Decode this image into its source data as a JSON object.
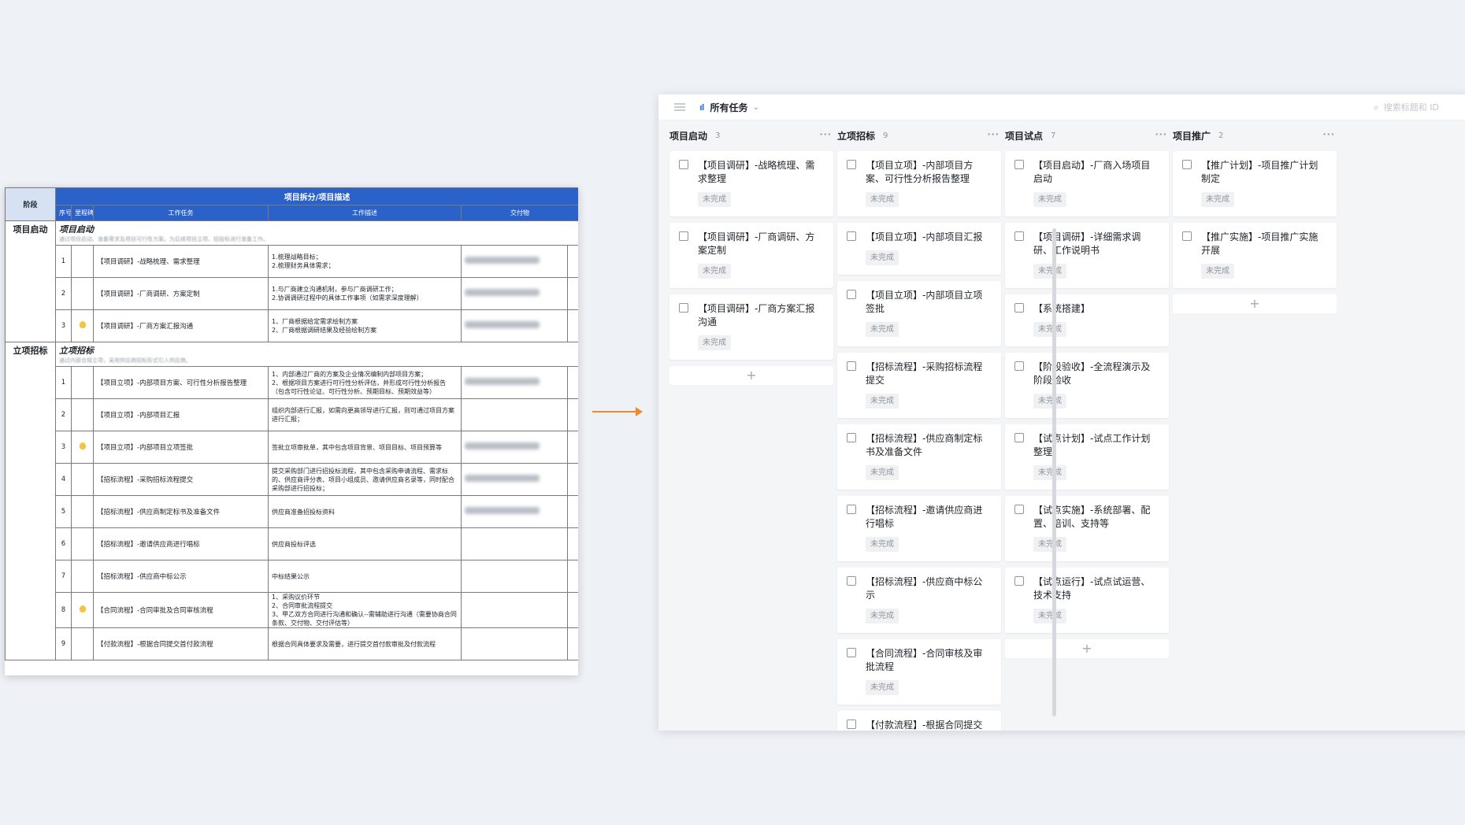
{
  "sheet": {
    "header_stage": "阶段",
    "header_title": "项目拆分/项目描述",
    "col_seq": "序号",
    "col_milestone": "里程碑",
    "col_task": "工作任务",
    "col_desc": "工作描述",
    "col_deliverable": "交付物",
    "sections": [
      {
        "stage": "项目启动",
        "title": "项目启动",
        "desc": "通过项目启动、准备需求及项目可行性方案。为后续项目立项、招投标进行准备工作。",
        "rows": [
          {
            "num": "1",
            "medal": false,
            "task": "【项目调研】-战略梳理、需求整理",
            "desc": "1.梳理战略目标；\n2.梳理财务具体需求；",
            "deliverable": true
          },
          {
            "num": "2",
            "medal": false,
            "task": "【项目调研】-厂商调研、方案定制",
            "desc": "1.与厂商建立沟通机制，参与厂商调研工作；\n2.协调调研过程中的具体工作事项（如需求深度理解）",
            "deliverable": true
          },
          {
            "num": "3",
            "medal": true,
            "task": "【项目调研】-厂商方案汇报沟通",
            "desc": "1、厂商根据给定需求绘制方案\n2、厂商根据调研结果及经验绘制方案",
            "deliverable": true
          }
        ]
      },
      {
        "stage": "立项招标",
        "title": "立项招标",
        "desc": "通过内部合规立项，采用供应商招标形式引入供应商。",
        "rows": [
          {
            "num": "1",
            "medal": false,
            "task": "【项目立项】-内部项目方案、可行性分析报告整理",
            "desc": "1、内部通过厂商的方案及企业情况编制内部项目方案；\n2、根据项目方案进行可行性分析评估，并形成可行性分析报告（包含可行性论证、可行性分析、预期目标、预期效益等）",
            "deliverable": true
          },
          {
            "num": "2",
            "medal": false,
            "task": "【项目立项】-内部项目汇报",
            "desc": "组织内部进行汇报，如需向更高领导进行汇报，则可通过项目方案进行汇报；",
            "deliverable": false
          },
          {
            "num": "3",
            "medal": true,
            "task": "【项目立项】-内部项目立项签批",
            "desc": "签批立项审批单，其中包含项目背景、项目目标、项目预算等",
            "deliverable": true
          },
          {
            "num": "4",
            "medal": false,
            "task": "【招标流程】-采购招标流程提交",
            "desc": "提交采购部门进行招投标流程，其中包含采购申请流程、需求标的、供应商评分表、项目小组成员、邀请供应商名录等，同时配合采购部进行招投标；",
            "deliverable": true
          },
          {
            "num": "5",
            "medal": false,
            "task": "【招标流程】-供应商制定标书及准备文件",
            "desc": "供应商准备招投标资料",
            "deliverable": true
          },
          {
            "num": "6",
            "medal": false,
            "task": "【招标流程】-邀请供应商进行唱标",
            "desc": "供应商投标评选",
            "deliverable": false
          },
          {
            "num": "7",
            "medal": false,
            "task": "【招标流程】-供应商中标公示",
            "desc": "中标结果公示",
            "deliverable": false
          },
          {
            "num": "8",
            "medal": true,
            "task": "【合同流程】-合同审批及合同审核流程",
            "desc": "1、采购议价环节\n2、合同审批流程提交\n3、甲乙双方合同进行沟通和确认--需辅助进行沟通（需要协商合同条款、交付物、交付评估等）",
            "deliverable": false
          },
          {
            "num": "9",
            "medal": false,
            "task": "【付款流程】-根据合同提交首付款流程",
            "desc": "根据合同具体要求及需要，进行提交首付款审批及付款流程",
            "deliverable": false
          }
        ]
      }
    ]
  },
  "board": {
    "view_name": "所有任务",
    "search_placeholder": "搜索标题和 ID",
    "add_symbol": "+",
    "more_symbol": "···",
    "columns": [
      {
        "title": "项目启动",
        "count": "3",
        "cards": [
          {
            "title": "【项目调研】-战略梳理、需求整理",
            "status": "未完成"
          },
          {
            "title": "【项目调研】-厂商调研、方案定制",
            "status": "未完成"
          },
          {
            "title": "【项目调研】-厂商方案汇报沟通",
            "status": "未完成"
          }
        ]
      },
      {
        "title": "立项招标",
        "count": "9",
        "cards": [
          {
            "title": "【项目立项】-内部项目方案、可行性分析报告整理",
            "status": "未完成"
          },
          {
            "title": "【项目立项】-内部项目汇报",
            "status": "未完成"
          },
          {
            "title": "【项目立项】-内部项目立项签批",
            "status": "未完成"
          },
          {
            "title": "【招标流程】-采购招标流程提交",
            "status": "未完成"
          },
          {
            "title": "【招标流程】-供应商制定标书及准备文件",
            "status": "未完成"
          },
          {
            "title": "【招标流程】-邀请供应商进行唱标",
            "status": "未完成"
          },
          {
            "title": "【招标流程】-供应商中标公示",
            "status": "未完成"
          },
          {
            "title": "【合同流程】-合同审核及审批流程",
            "status": "未完成"
          },
          {
            "title": "【付款流程】-根据合同提交首付",
            "status": ""
          }
        ]
      },
      {
        "title": "项目试点",
        "count": "7",
        "cards": [
          {
            "title": "【项目启动】-厂商入场项目启动",
            "status": "未完成"
          },
          {
            "title": "【项目调研】-详细需求调研、工作说明书",
            "status": "未完成"
          },
          {
            "title": "【系统搭建】",
            "status": "未完成"
          },
          {
            "title": "【阶段验收】-全流程演示及阶段验收",
            "status": "未完成"
          },
          {
            "title": "【试点计划】-试点工作计划整理",
            "status": "未完成"
          },
          {
            "title": "【试点实施】-系统部署、配置、培训、支持等",
            "status": "未完成"
          },
          {
            "title": "【试点运行】-试点试运营、技术支持",
            "status": "未完成"
          }
        ]
      },
      {
        "title": "项目推广",
        "count": "2",
        "cards": [
          {
            "title": "【推广计划】-项目推广计划制定",
            "status": "未完成"
          },
          {
            "title": "【推广实施】-项目推广实施开展",
            "status": "未完成"
          }
        ]
      }
    ]
  }
}
